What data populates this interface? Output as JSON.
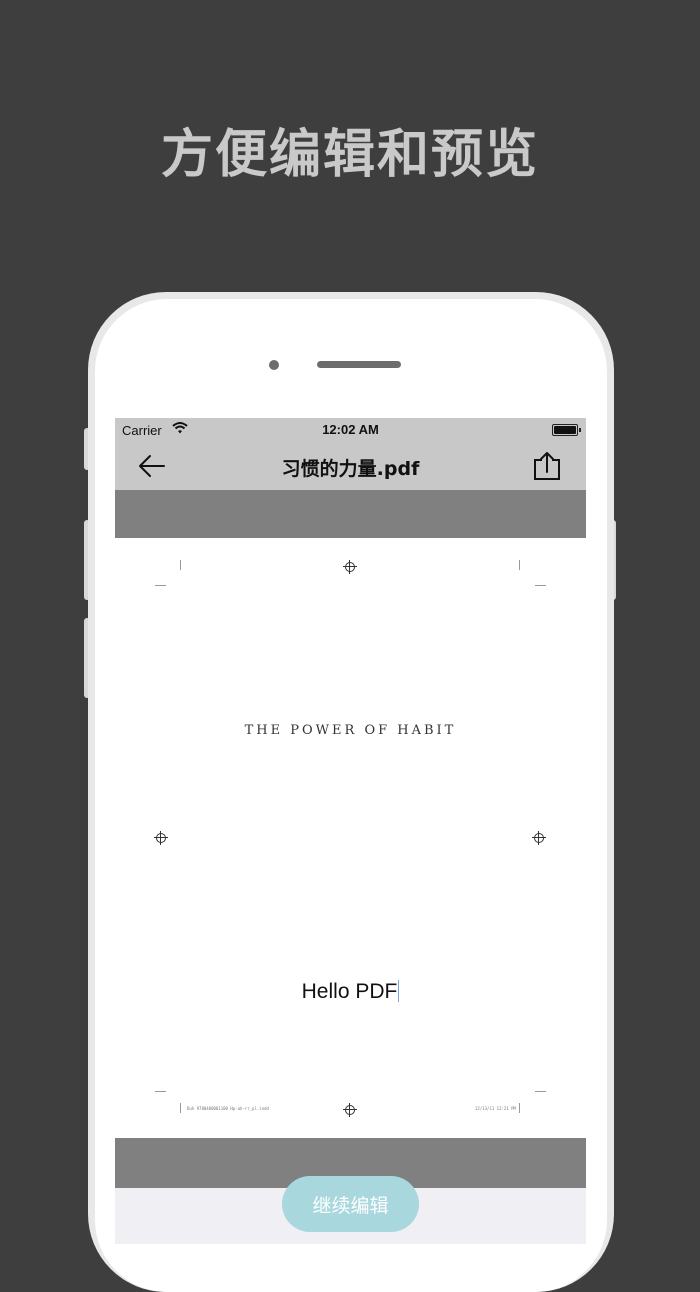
{
  "headline": "方便编辑和预览",
  "status_bar": {
    "carrier": "Carrier",
    "time": "12:02 AM"
  },
  "nav": {
    "title": "习惯的力量.pdf",
    "back_icon": "back-arrow-icon",
    "share_icon": "share-icon"
  },
  "document": {
    "book_title": "THE POWER OF HABIT",
    "body_text": "Hello PDF",
    "footer_left": "Duh 9780400001100 Hp-ah-rr_pl.indd",
    "footer_right": "12/13/11   12:21 PM"
  },
  "actions": {
    "continue_label": "继续编辑"
  },
  "colors": {
    "background": "#3e3e3e",
    "headline": "#c9c9c9",
    "bar": "#c8c8c8",
    "band": "#808080",
    "button": "#a9d7de"
  }
}
